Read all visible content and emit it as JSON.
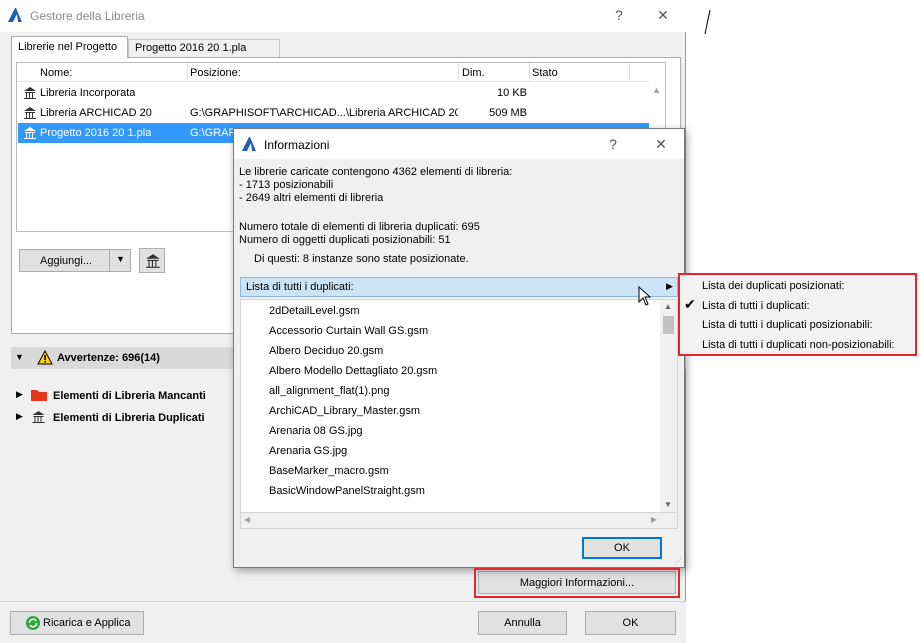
{
  "window": {
    "title": "Gestore della Libreria",
    "help": "?",
    "close": "✕"
  },
  "tabs": [
    {
      "label": "Librerie nel Progetto"
    },
    {
      "label": "Progetto 2016 20 1.pla"
    }
  ],
  "libraries": {
    "columns": [
      "Nome:",
      "Posizione:",
      "Dim.",
      "Stato"
    ],
    "rows": [
      {
        "name": "Libreria Incorporata",
        "position": "",
        "size": "10 KB",
        "status": ""
      },
      {
        "name": "Libreria ARCHICAD 20",
        "position": "G:\\GRAPHISOFT\\ARCHICAD...\\Libreria ARCHICAD 20",
        "size": "509 MB",
        "status": ""
      },
      {
        "name": "Progetto 2016 20 1.pla",
        "position": "G:\\GRAPHI",
        "size": "",
        "status": ""
      }
    ]
  },
  "add_button": "Aggiungi...",
  "warnings": "Avvertenze: 696(14)",
  "tree": [
    {
      "label": "Elementi di Libreria Mancanti"
    },
    {
      "label": "Elementi di Libreria Duplicati"
    }
  ],
  "more_info_button": "Maggiori Informazioni...",
  "reload_button": "Ricarica e Applica",
  "cancel_button": "Annulla",
  "ok_button": "OK",
  "dialog": {
    "title": "Informazioni",
    "help": "?",
    "close": "✕",
    "summary_line1": "Le librerie caricate contengono 4362 elementi di libreria:",
    "summary_line2": "- 1713 posizionabili",
    "summary_line3": "- 2649 altri elementi di libreria",
    "dup_total": "Numero totale di elementi di libreria duplicati: 695",
    "dup_placeable": "Numero di oggetti duplicati posizionabili: 51",
    "dup_placed": "Di questi: 8 instanze sono state posizionate.",
    "combo_value": "Lista di tutti i duplicati:",
    "duplicates": [
      "2dDetailLevel.gsm",
      "Accessorio Curtain Wall GS.gsm",
      "Albero Deciduo 20.gsm",
      "Albero Modello Dettagliato 20.gsm",
      "all_alignment_flat(1).png",
      "ArchiCAD_Library_Master.gsm",
      "Arenaria 08 GS.jpg",
      "Arenaria GS.jpg",
      "BaseMarker_macro.gsm",
      "BasicWindowPanelStraight.gsm"
    ],
    "ok": "OK"
  },
  "popup_menu": {
    "items": [
      {
        "label": "Lista dei duplicati posizionati:",
        "checked": false
      },
      {
        "label": "Lista di tutti i duplicati:",
        "checked": true
      },
      {
        "label": "Lista di tutti i duplicati posizionabili:",
        "checked": false
      },
      {
        "label": "Lista di tutti i duplicati non-posizionabili:",
        "checked": false
      }
    ]
  },
  "colors": {
    "selection": "#3399ff",
    "highlight_outline": "#e3262b",
    "combo_bg": "#cce4f7"
  }
}
